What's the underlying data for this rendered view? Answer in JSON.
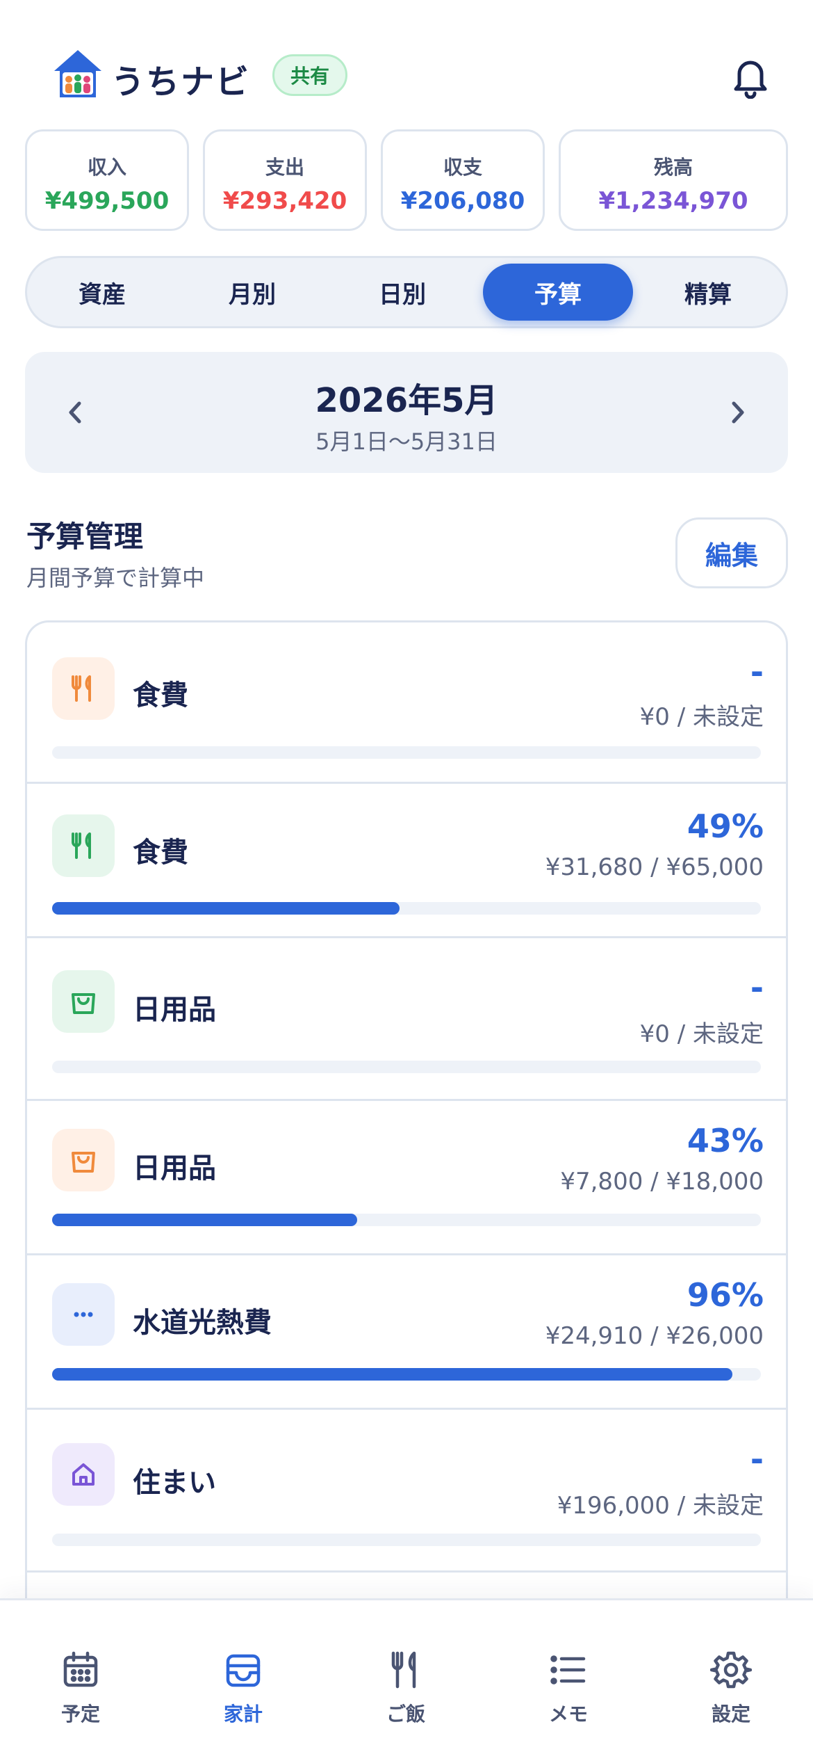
{
  "header": {
    "app_name": "うちナビ",
    "app_name_accent": "ヾ",
    "share_badge": "共有",
    "icons": [
      "house-logo-icon",
      "bell-icon"
    ]
  },
  "summary": [
    {
      "label": "収入",
      "value": "¥499,500",
      "color": "#2aa65a"
    },
    {
      "label": "支出",
      "value": "¥293,420",
      "color": "#f04b4b"
    },
    {
      "label": "収支",
      "value": "¥206,080",
      "color": "#2d66d9"
    },
    {
      "label": "残高",
      "value": "¥1,234,970",
      "color": "#7a55d6"
    }
  ],
  "tabs": [
    "資産",
    "月別",
    "日別",
    "予算",
    "精算"
  ],
  "active_tab": "予算",
  "month": {
    "title": "2026年5月",
    "range": "5月1日〜5月31日"
  },
  "budget": {
    "title": "予算管理",
    "subtitle": "月間予算で計算中",
    "edit_label": "編集"
  },
  "budget_items": [
    {
      "name": "食費",
      "percent": "-",
      "amount": "¥0 / 未設定",
      "progress": 0,
      "icon": "fork-knife-icon",
      "icon_color": "#f08a3c",
      "icon_bg": "#fff0e6"
    },
    {
      "name": "食費",
      "percent": "49%",
      "amount": "¥31,680 / ¥65,000",
      "progress": 0.49,
      "icon": "fork-knife-icon",
      "icon_color": "#2aa65a",
      "icon_bg": "#e6f6ec"
    },
    {
      "name": "日用品",
      "percent": "-",
      "amount": "¥0 / 未設定",
      "progress": 0,
      "icon": "shopping-bag-icon",
      "icon_color": "#2aa65a",
      "icon_bg": "#e6f6ec"
    },
    {
      "name": "日用品",
      "percent": "43%",
      "amount": "¥7,800 / ¥18,000",
      "progress": 0.43,
      "icon": "shopping-bag-icon",
      "icon_color": "#f08a3c",
      "icon_bg": "#fff0e6"
    },
    {
      "name": "水道光熱費",
      "percent": "96%",
      "amount": "¥24,910 / ¥26,000",
      "progress": 0.96,
      "icon": "more-dots-icon",
      "icon_color": "#2d66d9",
      "icon_bg": "#e8eefc"
    },
    {
      "name": "住まい",
      "percent": "-",
      "amount": "¥196,000 / 未設定",
      "progress": 0,
      "icon": "home-icon",
      "icon_color": "#7a55d6",
      "icon_bg": "#efeafc"
    }
  ],
  "bottom_nav": [
    {
      "label": "予定",
      "icon": "calendar-icon"
    },
    {
      "label": "家計",
      "icon": "wallet-icon"
    },
    {
      "label": "ご飯",
      "icon": "fork-knife-icon"
    },
    {
      "label": "メモ",
      "icon": "list-icon"
    },
    {
      "label": "設定",
      "icon": "gear-icon"
    }
  ],
  "active_nav": "家計"
}
